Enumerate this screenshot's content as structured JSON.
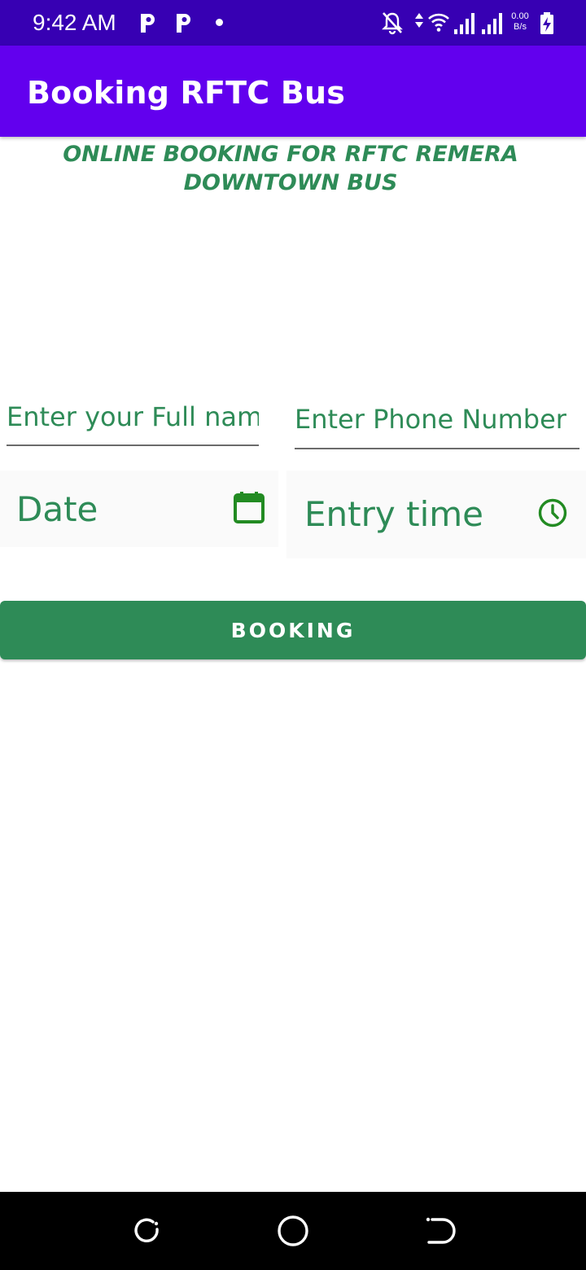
{
  "status_bar": {
    "time": "9:42 AM",
    "net_speed_value": "0.00",
    "net_speed_unit": "B/s",
    "left_icons": [
      "parking-app-icon",
      "parking-app-icon",
      "notification-dot"
    ],
    "right_icons": [
      "bell-off-icon",
      "data-arrows-icon",
      "wifi-icon",
      "signal-icon",
      "signal-icon",
      "battery-charging-icon"
    ]
  },
  "app_bar": {
    "title": "Booking RFTC Bus"
  },
  "main": {
    "heading_line1": "ONLINE BOOKING FOR RFTC REMERA",
    "heading_line2": "DOWNTOWN BUS",
    "name_field": {
      "placeholder": "Enter your Full nam",
      "value": ""
    },
    "phone_field": {
      "placeholder": "Enter Phone Number",
      "value": ""
    },
    "date_picker": {
      "label": "Date",
      "icon": "calendar-icon"
    },
    "time_picker": {
      "label": "Entry time",
      "icon": "clock-icon"
    },
    "booking_button": {
      "label": "BOOKING"
    }
  },
  "nav_bar": {
    "buttons": [
      "recents-icon",
      "home-icon",
      "back-icon"
    ]
  },
  "colors": {
    "status_bar": "#3700b3",
    "app_bar": "#6200ee",
    "accent_green": "#2e8b57",
    "icon_green": "#228b22",
    "nav_bar": "#000000"
  }
}
